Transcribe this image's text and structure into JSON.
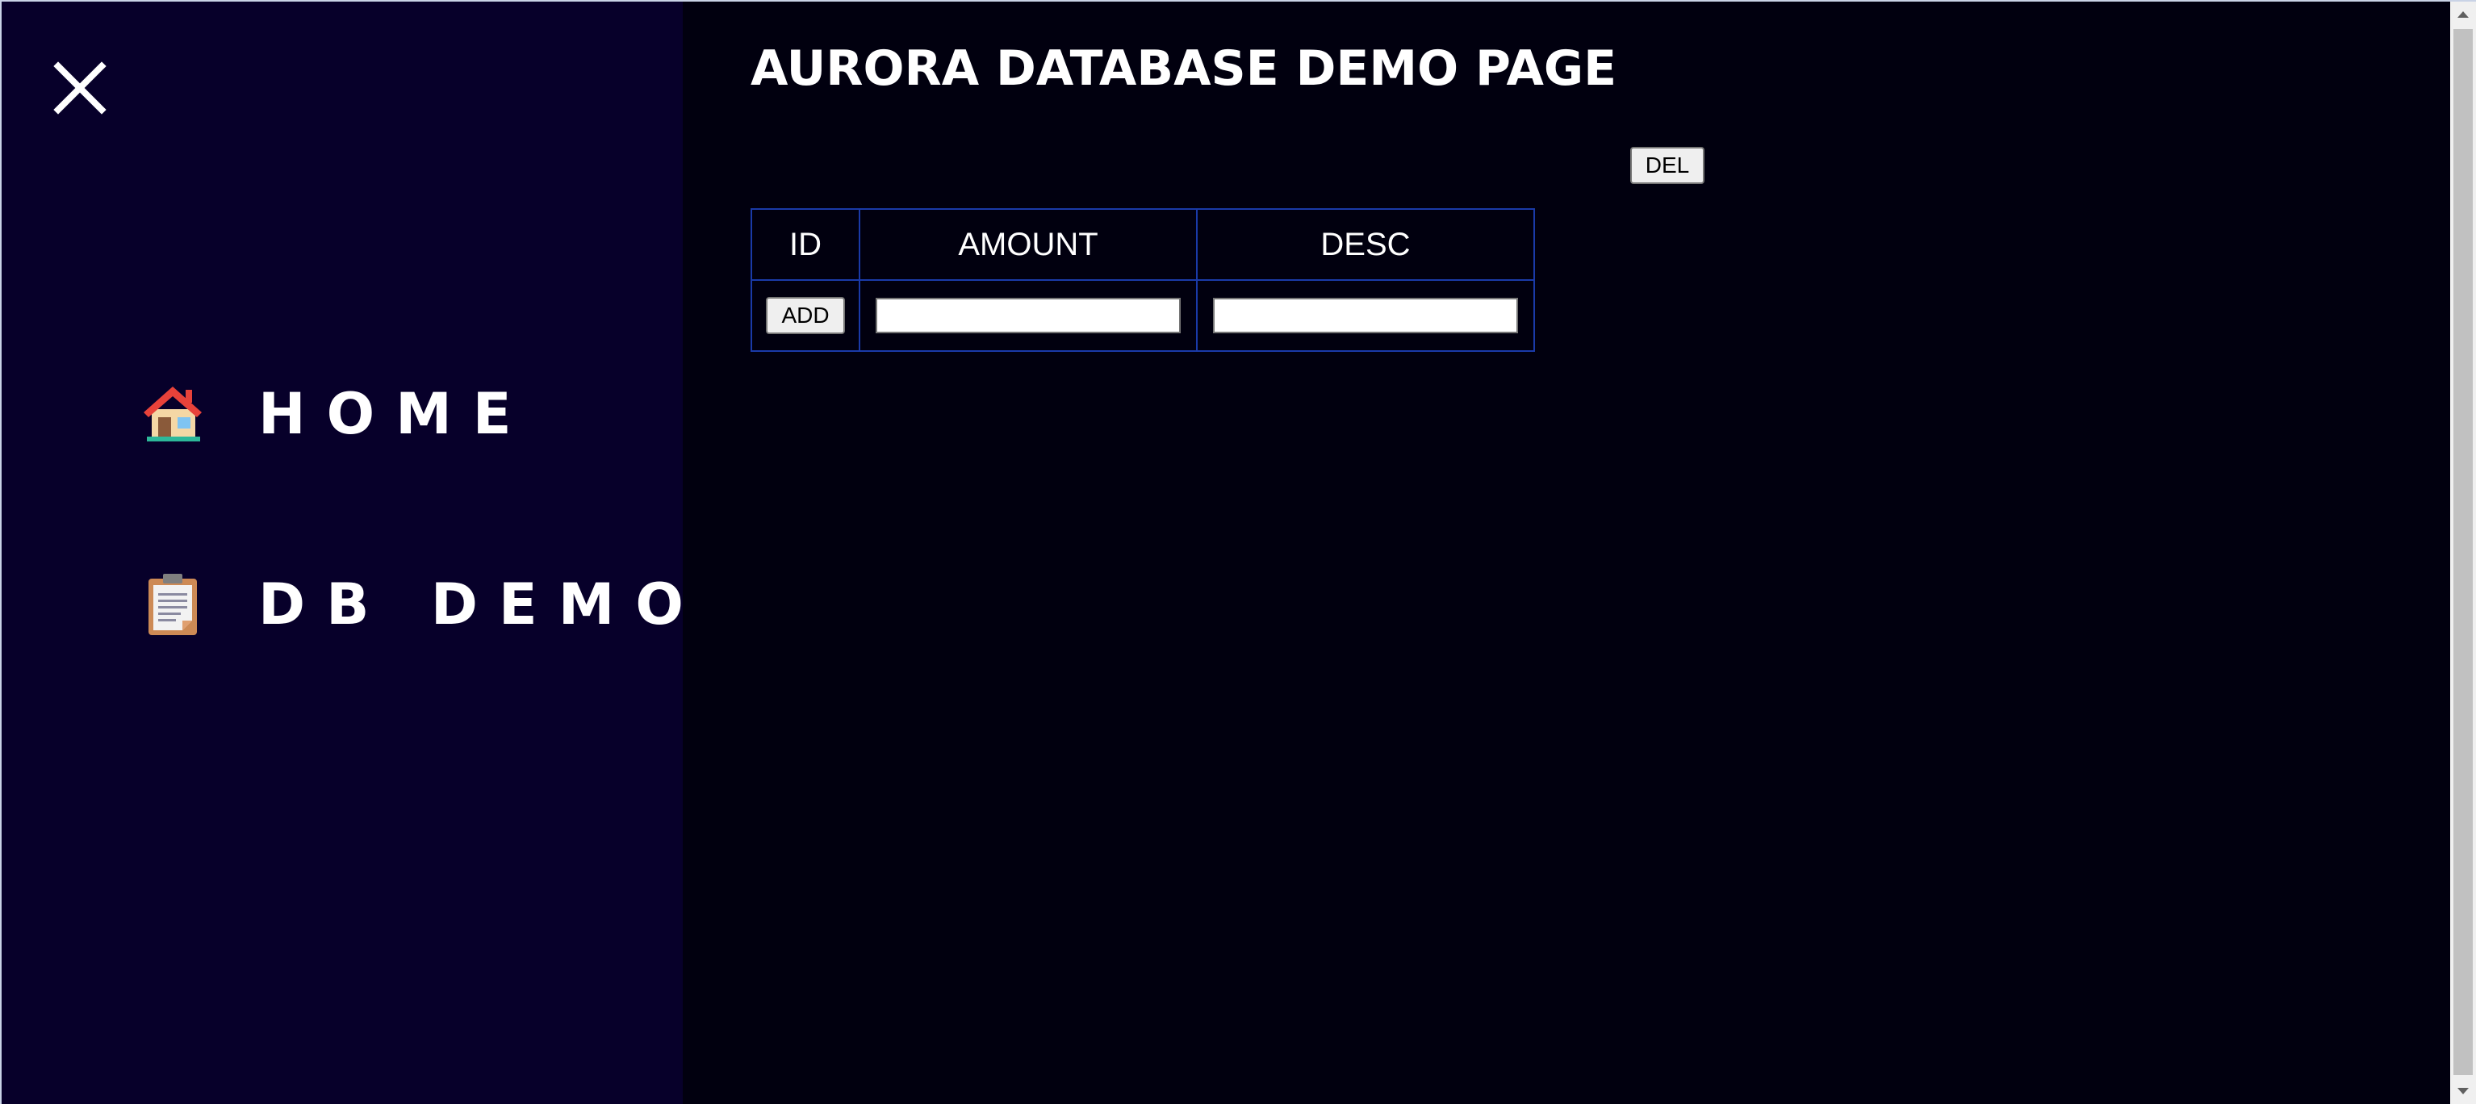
{
  "sidebar": {
    "close_icon": "close-icon",
    "items": [
      {
        "label": "HOME",
        "icon": "house-icon"
      },
      {
        "label": "DB DEMO",
        "icon": "clipboard-icon"
      }
    ]
  },
  "main": {
    "title": "AURORA DATABASE DEMO PAGE",
    "del_label": "DEL",
    "table": {
      "headers": [
        "ID",
        "AMOUNT",
        "DESC"
      ],
      "add_label": "ADD",
      "amount_value": "",
      "desc_value": ""
    }
  },
  "colors": {
    "sidebar_bg": "#07002a",
    "main_bg": "#01000f",
    "table_border": "#1a3aa8",
    "text": "#ffffff"
  }
}
